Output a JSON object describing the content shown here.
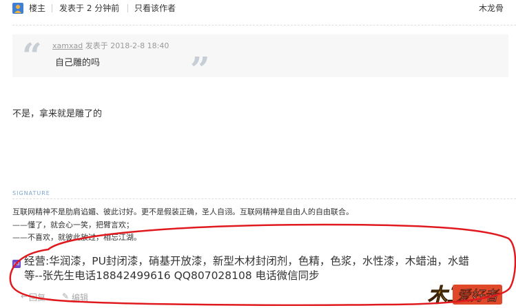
{
  "header": {
    "floor_label": "楼主",
    "posted_time": "发表于 2 分钟前",
    "only_author": "只看该作者",
    "username": "木龙骨"
  },
  "quote": {
    "author": "xamxad",
    "posted": "发表于 2018-2-8 18:40",
    "text": "自己雕的吗"
  },
  "reply": "不是，拿来就是雕了的",
  "signature": {
    "label": "SIGNATURE",
    "lines": [
      "互联网精神不是肋肩谄媚、彼此讨好。更不是假装正确，圣人自诩。互联网精神是自由人的自由联合。",
      "——懂了，就会心一笑，把臂言欢；",
      "——不喜欢，就彼此放过，相忘江湖。"
    ]
  },
  "ad": {
    "badge": "ad",
    "line1": "经营:华润漆，PU封闭漆，硝基开放漆，新型木材封闭剂，色精，色浆，水性漆，木蜡油，水蜡",
    "line2": "等--张先生电话18842499616 QQ807028108 电话微信同步"
  },
  "actions": {
    "reply": "回复",
    "edit": "编辑"
  },
  "logo": {
    "part1": "木工",
    "part2": "爱好者"
  },
  "colors": {
    "accent_red": "#e0191e",
    "link_blue": "#7aa3cf",
    "ad_badge": "#6d4acb"
  },
  "icons": [
    "user-icon",
    "quote-open-icon",
    "quote-close-icon",
    "reply-icon",
    "edit-icon"
  ]
}
